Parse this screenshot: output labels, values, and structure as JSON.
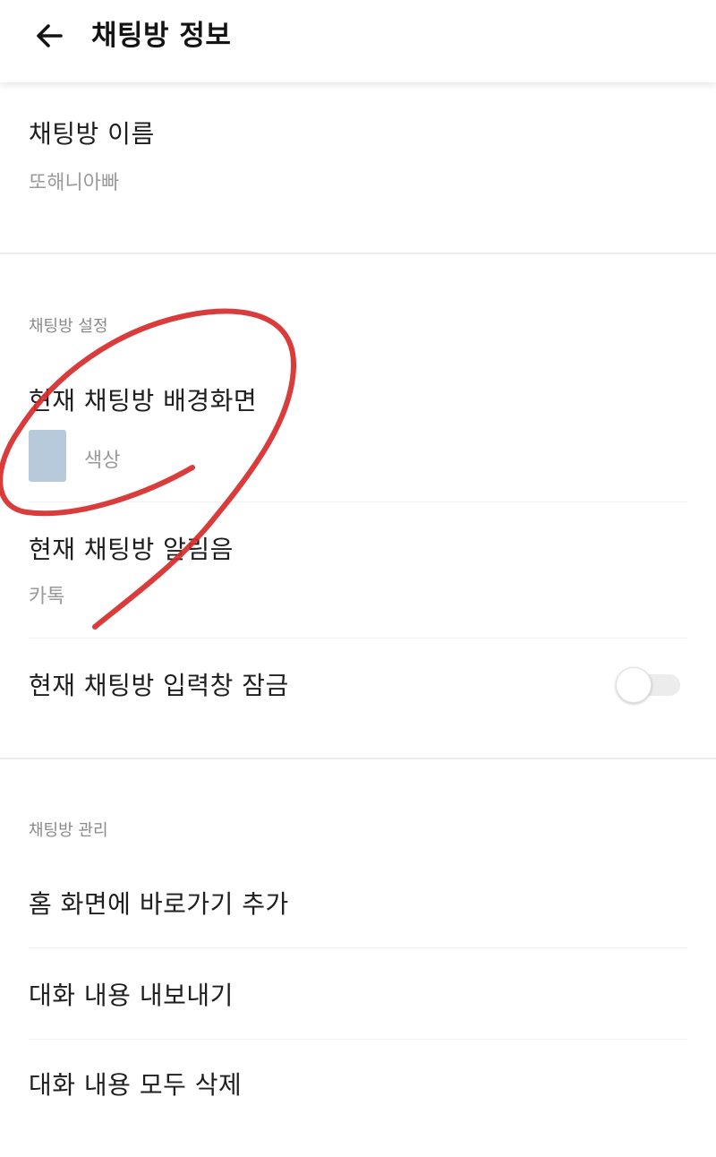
{
  "header": {
    "title": "채팅방 정보",
    "back_icon": "arrow-left-icon"
  },
  "room_name": {
    "label": "채팅방 이름",
    "value": "또해니아빠"
  },
  "settings": {
    "section_label": "채팅방 설정",
    "background": {
      "label": "현재 채팅방 배경화면",
      "value": "색상",
      "swatch_color": "#b7cadb"
    },
    "notification_sound": {
      "label": "현재 채팅방 알림음",
      "value": "카톡"
    },
    "input_lock": {
      "label": "현재 채팅방 입력창 잠금",
      "enabled": false
    }
  },
  "management": {
    "section_label": "채팅방 관리",
    "items": [
      {
        "label": "홈 화면에 바로가기 추가"
      },
      {
        "label": "대화 내용 내보내기"
      },
      {
        "label": "대화 내용 모두 삭제"
      }
    ]
  },
  "colors": {
    "annotation_red": "#d72b2b",
    "toggle_off_track": "#ececec"
  }
}
